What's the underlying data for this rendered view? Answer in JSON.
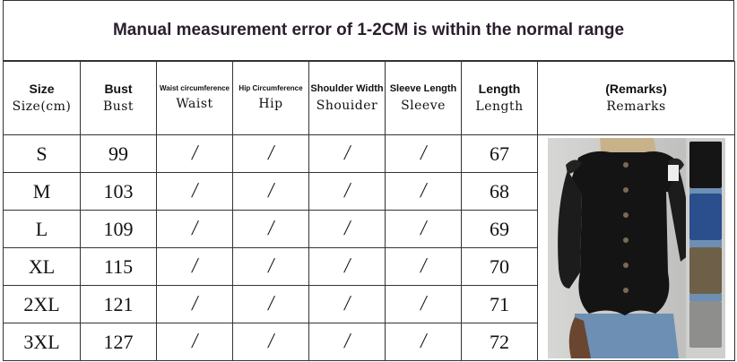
{
  "title": "Manual measurement error of 1-2CM is within the normal range",
  "headers": [
    {
      "en": "Size",
      "sub": "Size(cm)",
      "en_size": "normal"
    },
    {
      "en": "Bust",
      "sub": "Bust",
      "en_size": "normal"
    },
    {
      "en": "Waist circumference",
      "sub": "Waist",
      "en_size": "tiny"
    },
    {
      "en": "Hip Circumference",
      "sub": "Hip",
      "en_size": "tiny"
    },
    {
      "en": "Shoulder Width",
      "sub": "Shouider",
      "en_size": "small"
    },
    {
      "en": "Sleeve Length",
      "sub": "Sleeve",
      "en_size": "small"
    },
    {
      "en": "Length",
      "sub": "Length",
      "en_size": "normal"
    },
    {
      "en": "(Remarks)",
      "sub": "Remarks",
      "en_size": "normal"
    }
  ],
  "rows": [
    {
      "size": "S",
      "bust": "99",
      "waist": "/",
      "hip": "/",
      "shoulder": "/",
      "sleeve": "/",
      "length": "67"
    },
    {
      "size": "M",
      "bust": "103",
      "waist": "/",
      "hip": "/",
      "shoulder": "/",
      "sleeve": "/",
      "length": "68"
    },
    {
      "size": "L",
      "bust": "109",
      "waist": "/",
      "hip": "/",
      "shoulder": "/",
      "sleeve": "/",
      "length": "69"
    },
    {
      "size": "XL",
      "bust": "115",
      "waist": "/",
      "hip": "/",
      "shoulder": "/",
      "sleeve": "/",
      "length": "70"
    },
    {
      "size": "2XL",
      "bust": "121",
      "waist": "/",
      "hip": "/",
      "shoulder": "/",
      "sleeve": "/",
      "length": "71"
    },
    {
      "size": "3XL",
      "bust": "127",
      "waist": "/",
      "hip": "/",
      "shoulder": "/",
      "sleeve": "/",
      "length": "72"
    }
  ],
  "photo": {
    "main_color": "#141414",
    "swatch_colors": [
      "#151515",
      "#2a4f8c",
      "#6e6048",
      "#8e8e8c"
    ]
  }
}
